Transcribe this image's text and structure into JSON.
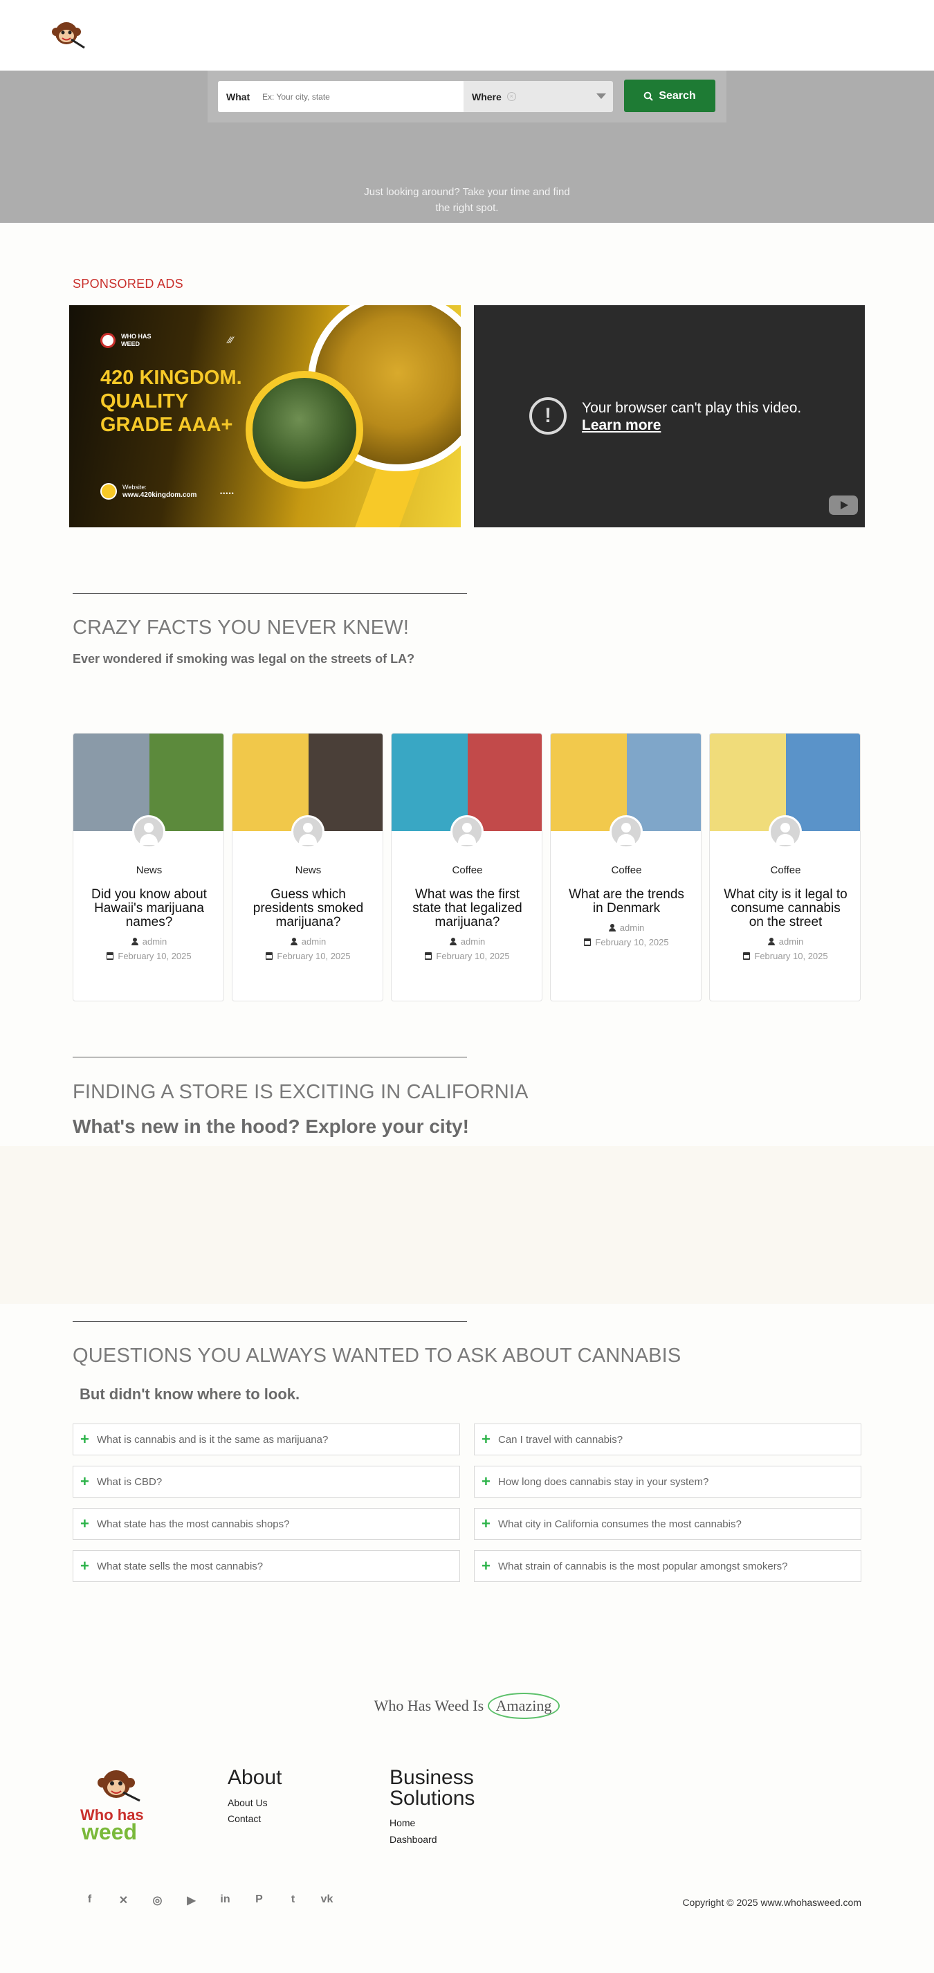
{
  "search": {
    "what_label": "What",
    "what_placeholder": "Ex: Your city, state",
    "where_label": "Where",
    "button_label": "Search"
  },
  "hero": {
    "tagline_line1": "Just looking around? Take your time and find",
    "tagline_line2": "the right spot."
  },
  "sponsored": {
    "heading": "SPONSORED ADS",
    "ad": {
      "brand_line1": "WHO HAS",
      "brand_line2": "WEED",
      "title_line1": "420 KINGDOM.",
      "title_line2": "QUALITY",
      "title_line3": "GRADE AAA+",
      "website_label": "Website:",
      "website": "www.420kingdom.com",
      "dots": "•••••"
    },
    "video": {
      "message": "Your browser can't play this video.",
      "link": "Learn more",
      "icon": "alert-icon"
    }
  },
  "facts": {
    "title": "CRAZY FACTS YOU NEVER KNEW!",
    "subtitle": "Ever wondered if smoking was legal on the streets of LA?",
    "cards": [
      {
        "category": "News",
        "title": "Did you know about Hawaii's marijuana names?",
        "author": "admin",
        "date": "February 10, 2025",
        "colors": [
          "#8a9aa8",
          "#5c8a3c"
        ]
      },
      {
        "category": "News",
        "title": "Guess which presidents smoked marijuana?",
        "author": "admin",
        "date": "February 10, 2025",
        "colors": [
          "#f1c84a",
          "#4a3f38"
        ]
      },
      {
        "category": "Coffee",
        "title": "What was the first state that legalized marijuana?",
        "author": "admin",
        "date": "February 10, 2025",
        "colors": [
          "#39a7c4",
          "#c24a4a"
        ]
      },
      {
        "category": "Coffee",
        "title": "What are the trends in Denmark",
        "author": "admin",
        "date": "February 10, 2025",
        "colors": [
          "#f2c94c",
          "#7fa6c9"
        ]
      },
      {
        "category": "Coffee",
        "title": "What city is it legal to consume cannabis on the street",
        "author": "admin",
        "date": "February 10, 2025",
        "colors": [
          "#f0dc7a",
          "#5a93c9"
        ]
      }
    ]
  },
  "store": {
    "title": "FINDING A STORE IS EXCITING IN CALIFORNIA",
    "subtitle": "What's new in the hood? Explore your city!"
  },
  "questions": {
    "title": "QUESTIONS YOU ALWAYS WANTED TO ASK ABOUT CANNABIS",
    "subtitle": "But didn't know where to look.",
    "left": [
      "What is cannabis and is it the same as marijuana?",
      "What is CBD?",
      "What state has the most cannabis shops?",
      "What state sells the most cannabis?"
    ],
    "right": [
      "Can I travel with cannabis?",
      "How long does cannabis stay in your system?",
      "What city in California consumes the most cannabis?",
      "What strain of cannabis is the most popular amongst smokers?"
    ]
  },
  "tagline": {
    "prefix": "Who Has Weed Is",
    "highlight": "Amazing"
  },
  "footer": {
    "logo_line1": "Who has",
    "logo_line2": "weed",
    "about": {
      "heading": "About",
      "links": [
        "About Us",
        "Contact"
      ]
    },
    "business": {
      "heading_line1": "Business",
      "heading_line2": "Solutions",
      "links": [
        "Home",
        "Dashboard"
      ]
    },
    "social": [
      {
        "icon": "facebook-icon",
        "glyph": "f"
      },
      {
        "icon": "x-icon",
        "glyph": "✕"
      },
      {
        "icon": "instagram-icon",
        "glyph": "◎"
      },
      {
        "icon": "youtube-icon",
        "glyph": "▶"
      },
      {
        "icon": "linkedin-icon",
        "glyph": "in"
      },
      {
        "icon": "pinterest-icon",
        "glyph": "P"
      },
      {
        "icon": "tumblr-icon",
        "glyph": "t"
      },
      {
        "icon": "vk-icon",
        "glyph": "vk"
      }
    ],
    "copyright": "Copyright © 2025 www.whohasweed.com"
  },
  "colors": {
    "accent_red": "#c9302c",
    "search_green": "#1e7b34",
    "plus_green": "#2cb34a"
  }
}
